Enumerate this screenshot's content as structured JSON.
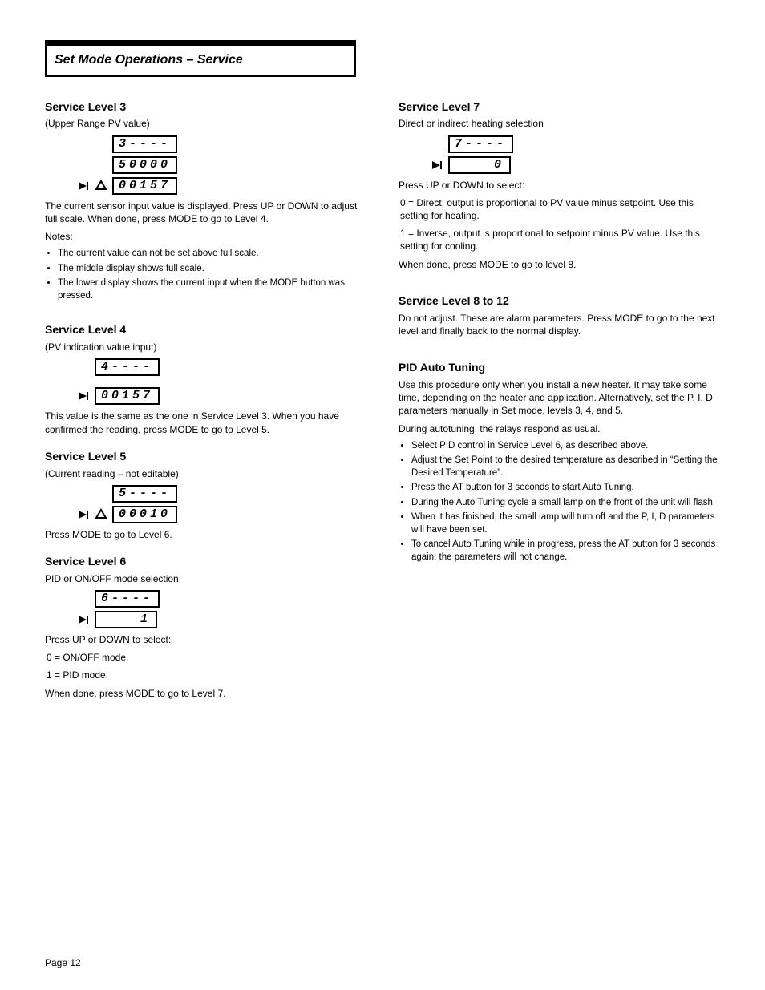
{
  "title": "Set Mode Operations – Service",
  "left": {
    "sec3": {
      "heading": "Service Level 3",
      "intro": "(Upper Range PV value)",
      "displays": [
        "3----",
        "50000",
        "00157"
      ],
      "after": "The current sensor input value is displayed. Press UP or DOWN to adjust full scale. When done, press MODE to go to Level 4.",
      "notes_label": "Notes:",
      "notes": [
        "The current value can not be set above full scale.",
        "The middle display shows full scale.",
        "The lower display shows the current input when the MODE button was pressed."
      ]
    },
    "sec4": {
      "heading": "Service Level 4",
      "intro": "(PV indication value input)",
      "displays": [
        "4----",
        "00157"
      ],
      "after": "This value is the same as the one in Service Level 3. When you have confirmed the reading, press MODE to go to Level 5."
    },
    "sec5": {
      "heading": "Service Level 5",
      "intro": "(Current reading – not editable)",
      "displays": [
        "5----",
        "00010"
      ],
      "after": "Press MODE to go to Level 6."
    },
    "sec6": {
      "heading": "Service Level 6",
      "sub": "PID or ON/OFF mode selection",
      "displays": [
        "6----",
        "1"
      ],
      "after_label": "Press UP or DOWN to select:",
      "opts": [
        "0 = ON/OFF mode.",
        "1 = PID mode."
      ],
      "tail": "When done, press MODE to go to Level 7."
    }
  },
  "right": {
    "sec7": {
      "heading": "Service Level 7",
      "sub": "Direct or indirect heating selection",
      "displays": [
        "7----",
        "0"
      ],
      "after_label": "Press UP or DOWN to select:",
      "opts": [
        "0 = Direct, output is proportional to PV value minus setpoint. Use this setting for heating.",
        "1 = Inverse, output is proportional to setpoint minus PV value. Use this setting for cooling."
      ],
      "tail": "When done, press MODE to go to level 8."
    },
    "sec8": {
      "heading": "Service Level 8 to 12",
      "para": "Do not adjust. These are alarm parameters. Press MODE to go to the next level and finally back to the normal display."
    },
    "auto": {
      "heading": "PID Auto Tuning",
      "p1": "Use this procedure only when you install a new heater. It may take some time, depending on the heater and application. Alternatively, set the P, I, D parameters manually in Set mode, levels 3, 4, and 5.",
      "p2": "During autotuning, the relays respond as usual.",
      "steps": [
        "Select PID control in Service Level 6, as described above.",
        "Adjust the Set Point to the desired temperature as described in “Setting the Desired Temperature”.",
        "Press the AT button for 3 seconds to start Auto Tuning.",
        "During the Auto Tuning cycle a small lamp on the front of the unit will flash.",
        "When it has finished, the small lamp will turn off and the P, I, D parameters will have been set.",
        "To cancel Auto Tuning while in progress, press the AT button for 3 seconds again; the parameters will not change."
      ]
    }
  },
  "footer": "Page 12"
}
